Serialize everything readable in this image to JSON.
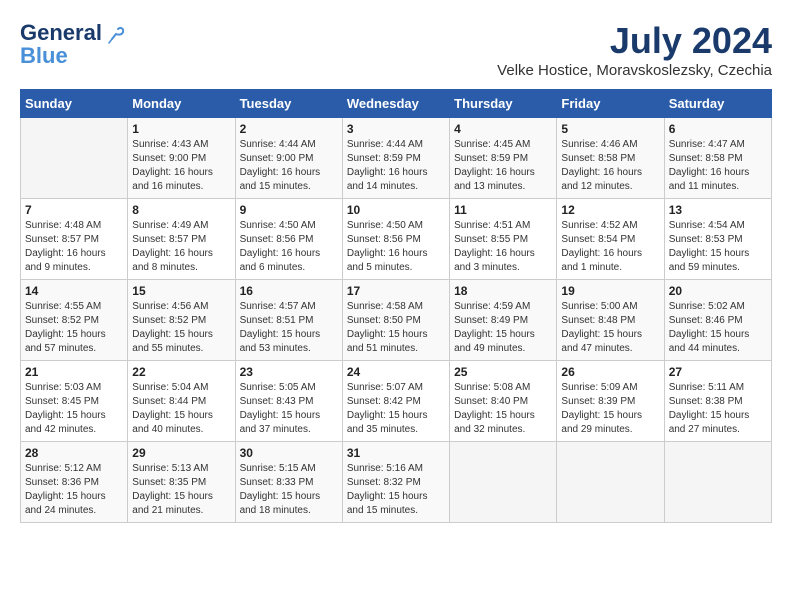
{
  "header": {
    "logo_general": "General",
    "logo_blue": "Blue",
    "month_title": "July 2024",
    "location": "Velke Hostice, Moravskoslezsky, Czechia"
  },
  "columns": [
    "Sunday",
    "Monday",
    "Tuesday",
    "Wednesday",
    "Thursday",
    "Friday",
    "Saturday"
  ],
  "weeks": [
    {
      "days": [
        {
          "num": "",
          "info": ""
        },
        {
          "num": "1",
          "info": "Sunrise: 4:43 AM\nSunset: 9:00 PM\nDaylight: 16 hours\nand 16 minutes."
        },
        {
          "num": "2",
          "info": "Sunrise: 4:44 AM\nSunset: 9:00 PM\nDaylight: 16 hours\nand 15 minutes."
        },
        {
          "num": "3",
          "info": "Sunrise: 4:44 AM\nSunset: 8:59 PM\nDaylight: 16 hours\nand 14 minutes."
        },
        {
          "num": "4",
          "info": "Sunrise: 4:45 AM\nSunset: 8:59 PM\nDaylight: 16 hours\nand 13 minutes."
        },
        {
          "num": "5",
          "info": "Sunrise: 4:46 AM\nSunset: 8:58 PM\nDaylight: 16 hours\nand 12 minutes."
        },
        {
          "num": "6",
          "info": "Sunrise: 4:47 AM\nSunset: 8:58 PM\nDaylight: 16 hours\nand 11 minutes."
        }
      ]
    },
    {
      "days": [
        {
          "num": "7",
          "info": "Sunrise: 4:48 AM\nSunset: 8:57 PM\nDaylight: 16 hours\nand 9 minutes."
        },
        {
          "num": "8",
          "info": "Sunrise: 4:49 AM\nSunset: 8:57 PM\nDaylight: 16 hours\nand 8 minutes."
        },
        {
          "num": "9",
          "info": "Sunrise: 4:50 AM\nSunset: 8:56 PM\nDaylight: 16 hours\nand 6 minutes."
        },
        {
          "num": "10",
          "info": "Sunrise: 4:50 AM\nSunset: 8:56 PM\nDaylight: 16 hours\nand 5 minutes."
        },
        {
          "num": "11",
          "info": "Sunrise: 4:51 AM\nSunset: 8:55 PM\nDaylight: 16 hours\nand 3 minutes."
        },
        {
          "num": "12",
          "info": "Sunrise: 4:52 AM\nSunset: 8:54 PM\nDaylight: 16 hours\nand 1 minute."
        },
        {
          "num": "13",
          "info": "Sunrise: 4:54 AM\nSunset: 8:53 PM\nDaylight: 15 hours\nand 59 minutes."
        }
      ]
    },
    {
      "days": [
        {
          "num": "14",
          "info": "Sunrise: 4:55 AM\nSunset: 8:52 PM\nDaylight: 15 hours\nand 57 minutes."
        },
        {
          "num": "15",
          "info": "Sunrise: 4:56 AM\nSunset: 8:52 PM\nDaylight: 15 hours\nand 55 minutes."
        },
        {
          "num": "16",
          "info": "Sunrise: 4:57 AM\nSunset: 8:51 PM\nDaylight: 15 hours\nand 53 minutes."
        },
        {
          "num": "17",
          "info": "Sunrise: 4:58 AM\nSunset: 8:50 PM\nDaylight: 15 hours\nand 51 minutes."
        },
        {
          "num": "18",
          "info": "Sunrise: 4:59 AM\nSunset: 8:49 PM\nDaylight: 15 hours\nand 49 minutes."
        },
        {
          "num": "19",
          "info": "Sunrise: 5:00 AM\nSunset: 8:48 PM\nDaylight: 15 hours\nand 47 minutes."
        },
        {
          "num": "20",
          "info": "Sunrise: 5:02 AM\nSunset: 8:46 PM\nDaylight: 15 hours\nand 44 minutes."
        }
      ]
    },
    {
      "days": [
        {
          "num": "21",
          "info": "Sunrise: 5:03 AM\nSunset: 8:45 PM\nDaylight: 15 hours\nand 42 minutes."
        },
        {
          "num": "22",
          "info": "Sunrise: 5:04 AM\nSunset: 8:44 PM\nDaylight: 15 hours\nand 40 minutes."
        },
        {
          "num": "23",
          "info": "Sunrise: 5:05 AM\nSunset: 8:43 PM\nDaylight: 15 hours\nand 37 minutes."
        },
        {
          "num": "24",
          "info": "Sunrise: 5:07 AM\nSunset: 8:42 PM\nDaylight: 15 hours\nand 35 minutes."
        },
        {
          "num": "25",
          "info": "Sunrise: 5:08 AM\nSunset: 8:40 PM\nDaylight: 15 hours\nand 32 minutes."
        },
        {
          "num": "26",
          "info": "Sunrise: 5:09 AM\nSunset: 8:39 PM\nDaylight: 15 hours\nand 29 minutes."
        },
        {
          "num": "27",
          "info": "Sunrise: 5:11 AM\nSunset: 8:38 PM\nDaylight: 15 hours\nand 27 minutes."
        }
      ]
    },
    {
      "days": [
        {
          "num": "28",
          "info": "Sunrise: 5:12 AM\nSunset: 8:36 PM\nDaylight: 15 hours\nand 24 minutes."
        },
        {
          "num": "29",
          "info": "Sunrise: 5:13 AM\nSunset: 8:35 PM\nDaylight: 15 hours\nand 21 minutes."
        },
        {
          "num": "30",
          "info": "Sunrise: 5:15 AM\nSunset: 8:33 PM\nDaylight: 15 hours\nand 18 minutes."
        },
        {
          "num": "31",
          "info": "Sunrise: 5:16 AM\nSunset: 8:32 PM\nDaylight: 15 hours\nand 15 minutes."
        },
        {
          "num": "",
          "info": ""
        },
        {
          "num": "",
          "info": ""
        },
        {
          "num": "",
          "info": ""
        }
      ]
    }
  ]
}
